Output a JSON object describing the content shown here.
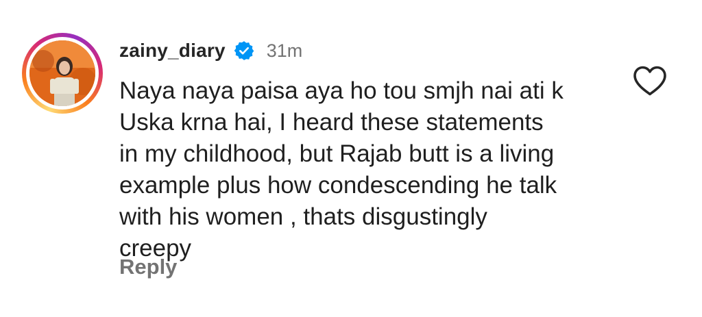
{
  "comment": {
    "username": "zainy_diary",
    "verified": true,
    "time": "31m",
    "text_lines": [
      "Naya naya paisa aya ho tou smjh nai ati k",
      "Uska krna hai, I heard these statements",
      "in my childhood, but Rajab butt is a living",
      "example plus how condescending he talk",
      "with his women , thats disgustingly",
      "creepy"
    ],
    "reply_label": "Reply",
    "liked": false
  },
  "icons": {
    "verified": "verified-badge-icon",
    "like": "heart-outline-icon",
    "avatar": "profile-picture"
  },
  "colors": {
    "username": "#262626",
    "meta": "#737373",
    "text": "#1f1f1f",
    "verified_blue": "#0095f6",
    "story_ring": [
      "#feda75",
      "#fa7e1e",
      "#d62976",
      "#962fbf"
    ]
  }
}
